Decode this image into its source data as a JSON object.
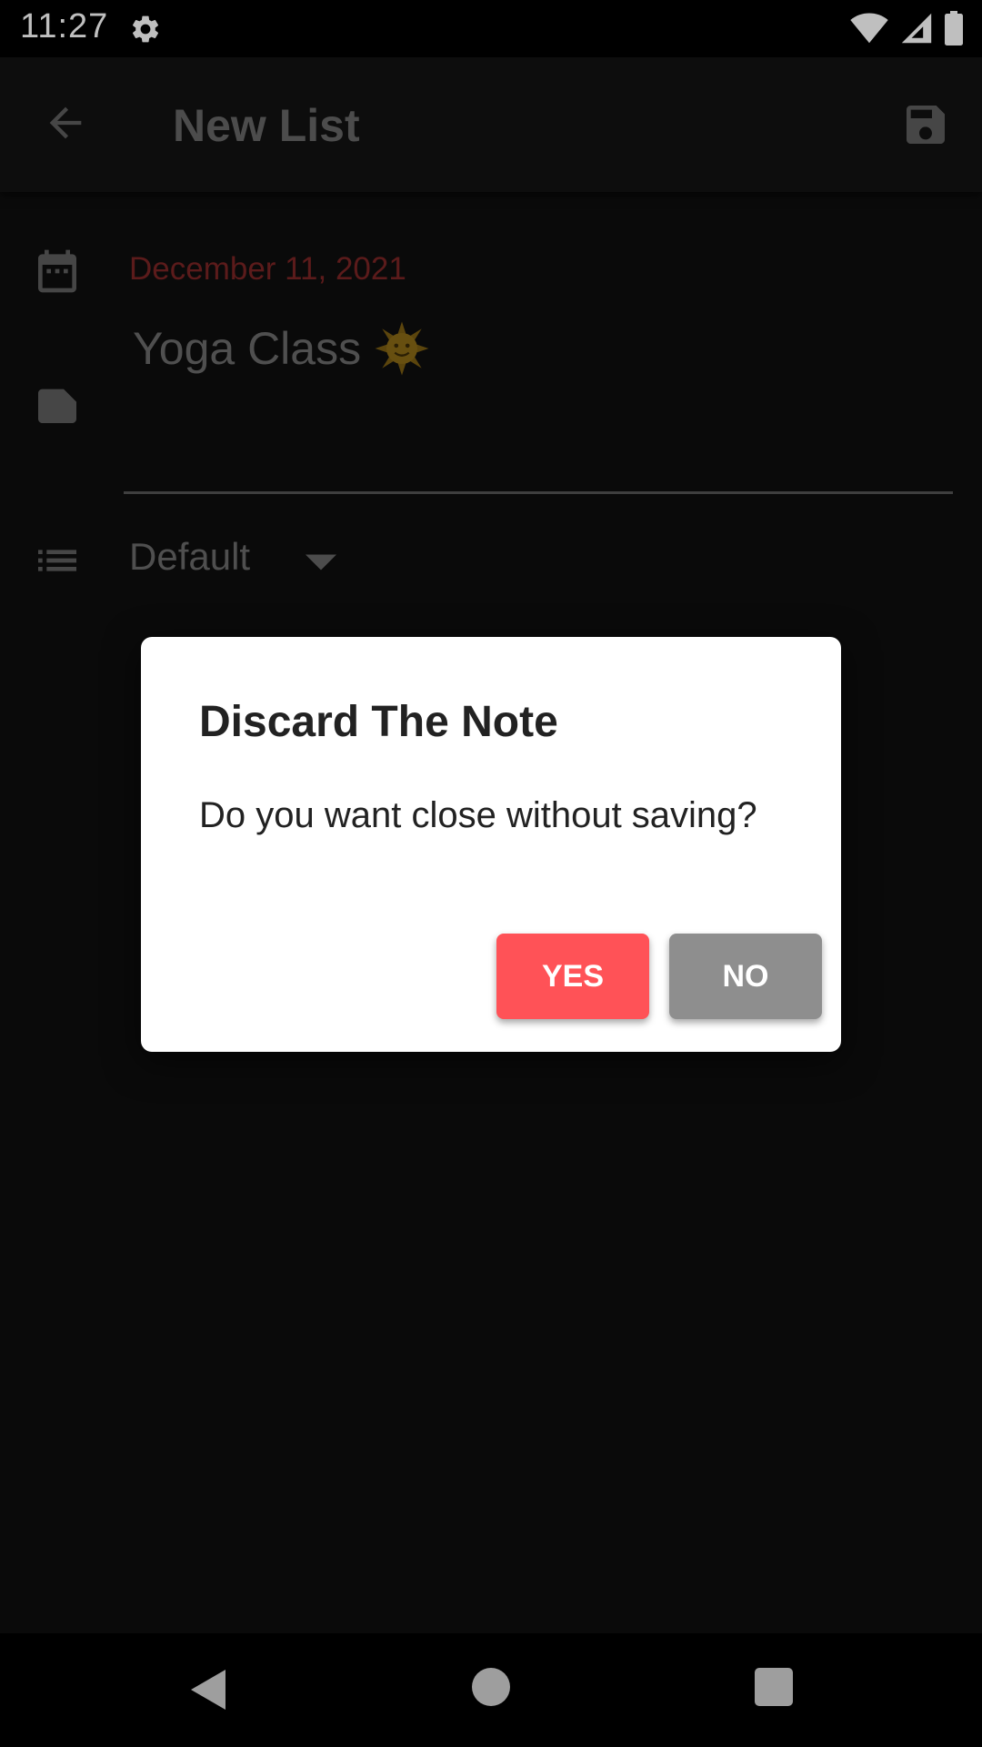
{
  "status_bar": {
    "time": "11:27"
  },
  "app_bar": {
    "title": "New List"
  },
  "form": {
    "date": "December 11, 2021",
    "note": "Yoga Class",
    "list_value": "Default"
  },
  "dialog": {
    "title": "Discard The Note",
    "message": "Do you want close without saving?",
    "yes_label": "YES",
    "no_label": "NO"
  },
  "colors": {
    "yes_button": "#ff5257",
    "no_button": "#8e8e8e",
    "date_text": "#7a2424"
  }
}
